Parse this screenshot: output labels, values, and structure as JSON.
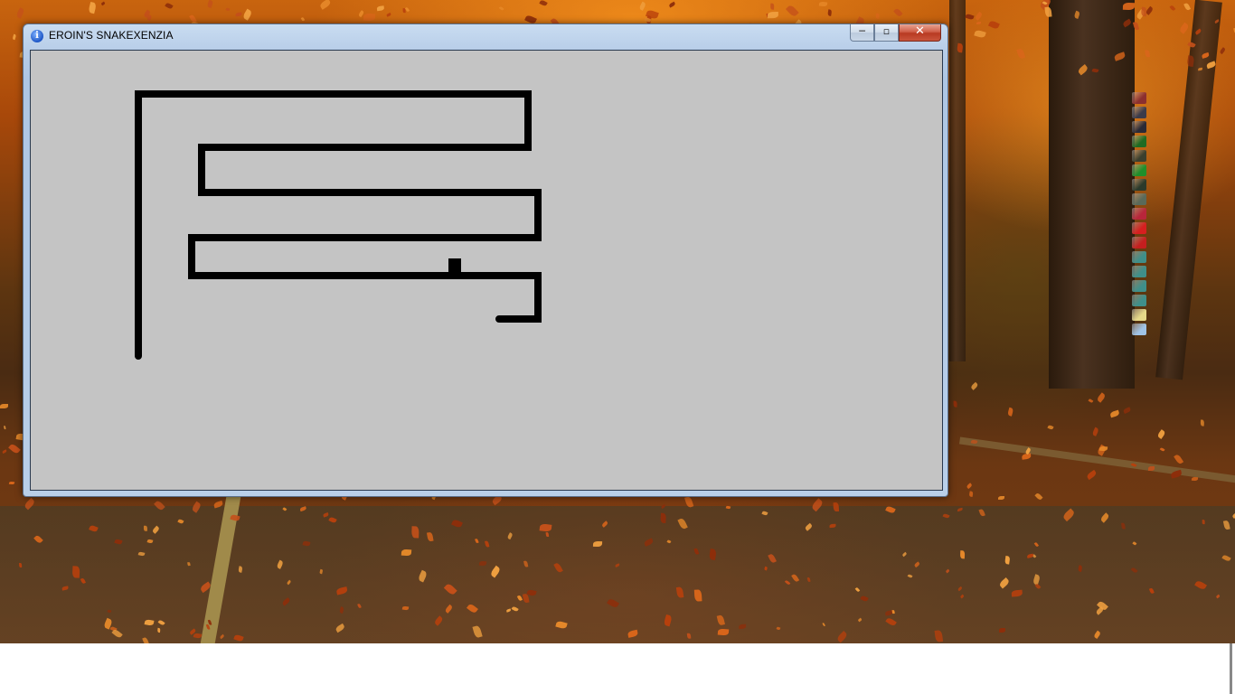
{
  "window": {
    "title": "EROIN'S SNAKEXENZIA",
    "controls": {
      "minimize": "─",
      "maximize": "▫",
      "close": "✕"
    }
  },
  "game": {
    "background_color": "#c4c4c4",
    "snake_color": "#000000"
  },
  "desktop": {
    "side_icons": [
      {
        "icon": "game-icon-red-swirl",
        "color": "#8b2f2f"
      },
      {
        "icon": "game-icon-soldier",
        "color": "#3b3b4a"
      },
      {
        "icon": "game-icon-assassin",
        "color": "#2a2a36"
      },
      {
        "icon": "game-icon-green-star",
        "color": "#1e6b23"
      },
      {
        "icon": "game-icon-soldier-dark",
        "color": "#3a3f2e"
      },
      {
        "icon": "game-icon-mw2",
        "color": "#1f8f2b"
      },
      {
        "icon": "game-icon-mw",
        "color": "#2b3a2b"
      },
      {
        "icon": "game-icon-team",
        "color": "#5a6a5a"
      },
      {
        "icon": "game-icon-fighter",
        "color": "#b8263b"
      },
      {
        "icon": "game-icon-13",
        "color": "#d61f1f"
      },
      {
        "icon": "game-icon-red-logo",
        "color": "#c51f1f"
      },
      {
        "icon": "app-icon-window",
        "color": "#3f8f8a"
      },
      {
        "icon": "app-icon-window",
        "color": "#3f8f8a"
      },
      {
        "icon": "app-icon-window",
        "color": "#3f8f8a"
      },
      {
        "icon": "app-icon-window",
        "color": "#3f8f8a"
      },
      {
        "icon": "folder-icon",
        "color": "#e6d98a"
      },
      {
        "icon": "recycle-bin-icon",
        "color": "#9fc3e6"
      }
    ]
  }
}
